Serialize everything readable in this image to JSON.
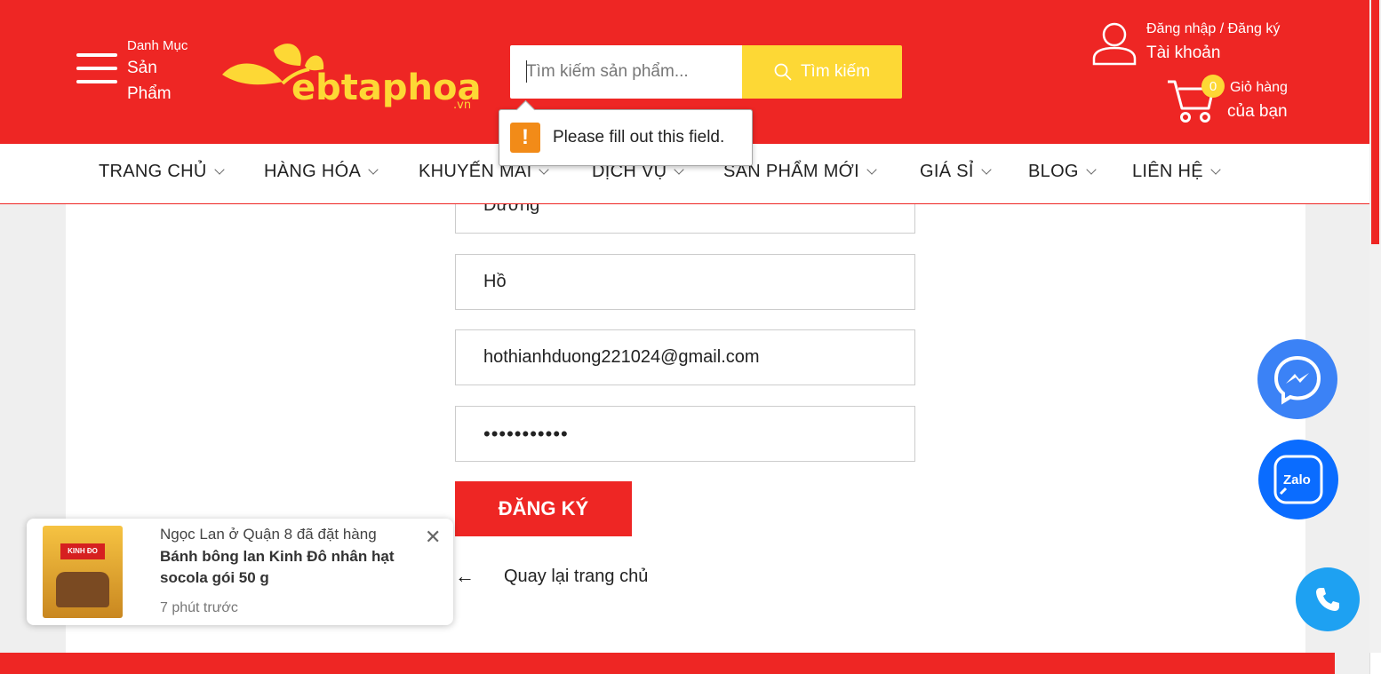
{
  "header": {
    "category_small": "Danh Mục",
    "category_big_1": "Sản",
    "category_big_2": "Phẩm",
    "logo_text": "ebtaphoa",
    "logo_suffix": ".vn",
    "search": {
      "placeholder": "Tìm kiếm sản phẩm...",
      "button_label": "Tìm kiếm"
    },
    "validation_message": "Please fill out this field.",
    "account": {
      "login_register": "Đăng nhập / Đăng ký",
      "label": "Tài khoản"
    },
    "cart": {
      "count": "0",
      "label1": "Giỏ hàng",
      "label2": "của bạn"
    }
  },
  "nav": {
    "items": [
      {
        "label": "TRANG CHỦ"
      },
      {
        "label": "HÀNG HÓA"
      },
      {
        "label": "KHUYẾN MÃI"
      },
      {
        "label": "DỊCH VỤ"
      },
      {
        "label": "SẢN PHẨM MỚI"
      },
      {
        "label": "GIÁ SỈ"
      },
      {
        "label": "BLOG"
      },
      {
        "label": "LIÊN HỆ"
      }
    ]
  },
  "form": {
    "first_name": "Dương",
    "last_name": "Hồ",
    "email": "hothianhduong221024@gmail.com",
    "password_mask": "•••••••••••",
    "submit_label": "ĐĂNG KÝ",
    "back_label": "Quay lại trang chủ"
  },
  "popup": {
    "line1": "Ngọc Lan ở Quận 8 đã đặt hàng",
    "product": "Bánh bông lan Kinh Đô nhân hạt socola gói 50 g",
    "time": "7 phút trước",
    "brand": "KINH ĐO"
  },
  "colors": {
    "brand_red": "#ee2624",
    "accent_yellow": "#fdd835",
    "messenger_blue": "#3b82f6",
    "zalo_blue": "#0a6cff"
  },
  "fabs": {
    "zalo_label": "Zalo"
  }
}
